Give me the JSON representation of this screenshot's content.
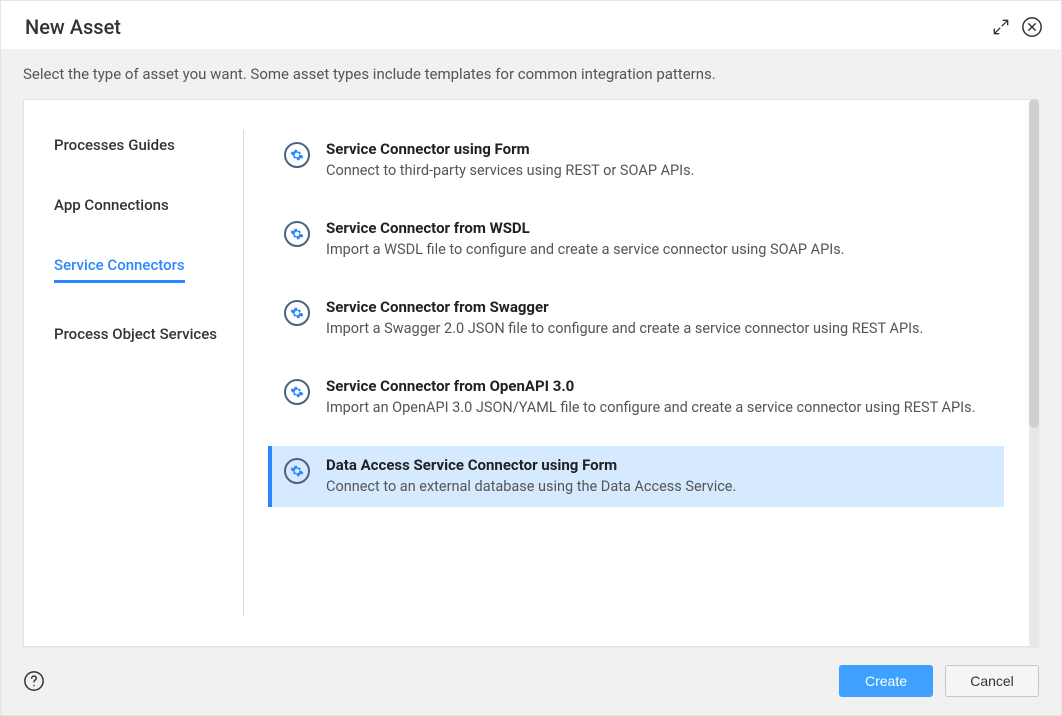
{
  "title": "New Asset",
  "subtitle": "Select the type of asset you want. Some asset types include templates for common integration patterns.",
  "sidebar": {
    "items": [
      {
        "label": "Processes",
        "active": false
      },
      {
        "label": "Guides",
        "active": false
      },
      {
        "label": "App Connections",
        "active": false
      },
      {
        "label": "Service Connectors",
        "active": true
      },
      {
        "label": "Process Object",
        "active": false
      },
      {
        "label": "Services",
        "active": false
      }
    ]
  },
  "options": [
    {
      "title": "Service Connector using Form",
      "desc": "Connect to third-party services using REST or SOAP APIs.",
      "selected": false
    },
    {
      "title": "Service Connector from WSDL",
      "desc": "Import a WSDL file to configure and create a service connector using SOAP APIs.",
      "selected": false
    },
    {
      "title": "Service Connector from Swagger",
      "desc": "Import a Swagger 2.0 JSON file to configure and create a service connector using REST APIs.",
      "selected": false
    },
    {
      "title": "Service Connector from OpenAPI 3.0",
      "desc": "Import an OpenAPI 3.0 JSON/YAML file to configure and create a service connector using REST APIs.",
      "selected": false
    },
    {
      "title": "Data Access Service Connector using Form",
      "desc": "Connect to an external database using the Data Access Service.",
      "selected": true
    }
  ],
  "buttons": {
    "create": "Create",
    "cancel": "Cancel"
  },
  "icons": {
    "gear": "gear-icon",
    "expand": "expand-icon",
    "close": "close-icon",
    "help": "help-icon"
  }
}
